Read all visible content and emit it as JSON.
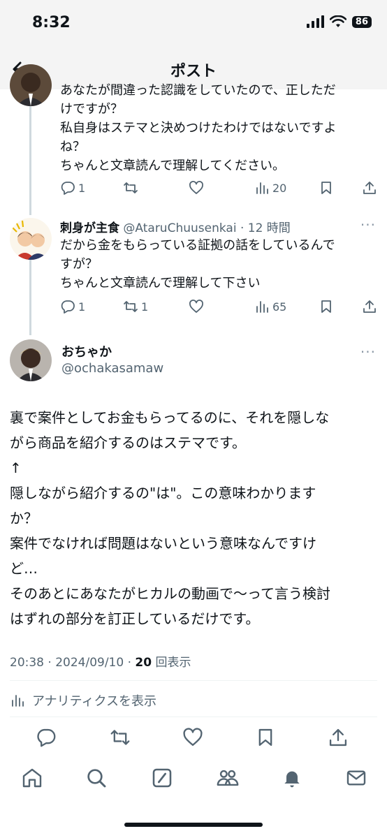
{
  "status_bar": {
    "time": "8:32",
    "battery": "86"
  },
  "nav": {
    "title": "ポスト"
  },
  "reply1": {
    "lines": [
      "あなたが間違った認識をしていたので、正しただ",
      "けですが？",
      "私自身はステマと決めつけたわけではないですよ",
      "ね？",
      "ちゃんと文章読んで理解してください。"
    ],
    "reply_count": "1",
    "retweet_count": "",
    "like_count": "",
    "view_count": "20"
  },
  "reply2": {
    "author_name": "刺身が主食",
    "author_handle": "@AtaruChuusenkai · 12 時間",
    "lines": [
      "だから金をもらっている証拠の話をしているんで",
      "すが？",
      "ちゃんと文章読んで理解して下さい"
    ],
    "reply_count": "1",
    "retweet_count": "1",
    "like_count": "",
    "view_count": "65"
  },
  "main_post": {
    "author_name": "おちゃか",
    "author_handle": "@ochakasamaw",
    "lines": [
      "裏で案件としてお金もらってるのに、それを隠しな",
      "がら商品を紹介するのはステマです。",
      "↑",
      "隠しながら紹介するの\"は\"。この意味わかります",
      "か？",
      "案件でなければ問題はないという意味なんですけ",
      "ど…",
      "そのあとにあなたがヒカルの動画で〜って言う検討",
      "はずれの部分を訂正しているだけです。"
    ],
    "timestamp": "20:38 · 2024/09/10 · ",
    "view_count": "20",
    "view_label": " 回表示",
    "analytics_label": "アナリティクスを表示"
  },
  "more_icon": "···",
  "colors": {
    "text": "#0f1419",
    "secondary": "#536471",
    "line": "#cfd9de"
  }
}
